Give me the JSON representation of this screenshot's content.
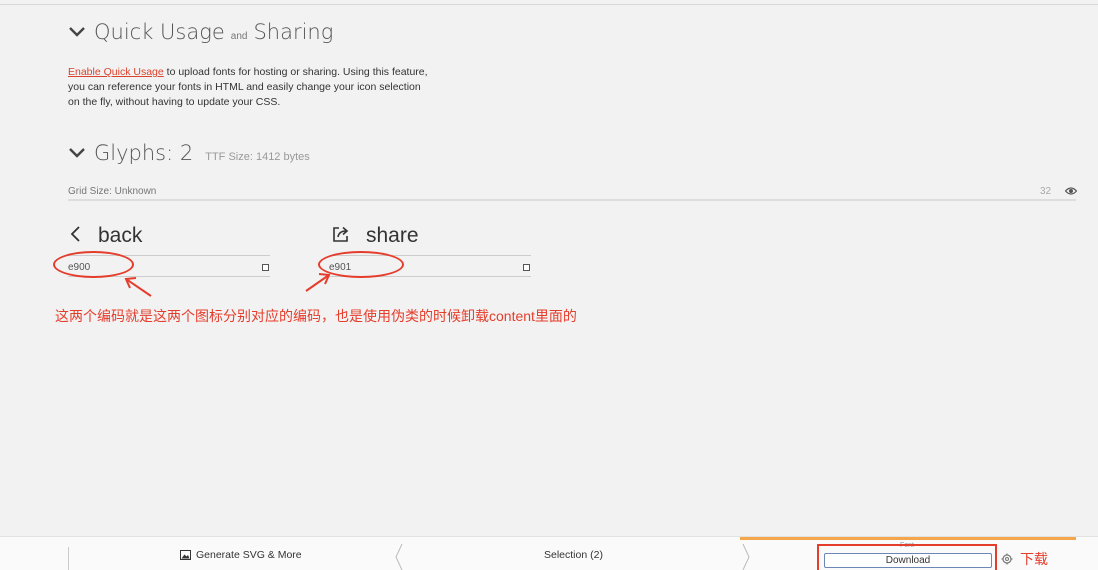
{
  "quick_usage": {
    "title_part1": "Quick Usage",
    "title_part2": "and",
    "title_part3": "Sharing",
    "link_text": "Enable Quick Usage",
    "description": " to upload fonts for hosting or sharing. Using this feature, you can reference your fonts in HTML and easily change your icon selection on the fly, without having to update your CSS."
  },
  "glyphs": {
    "title": "Glyphs: 2",
    "ttf_size": "TTF Size: 1412 bytes",
    "grid_label": "Grid Size: Unknown",
    "grid_size": "32",
    "items": [
      {
        "name": "back",
        "code": "e900",
        "icon": "chevron-left-icon"
      },
      {
        "name": "share",
        "code": "e901",
        "icon": "share-icon"
      }
    ]
  },
  "annotations": {
    "glyph_note": "这两个编码就是这两个图标分别对应的编码，也是使用伪类的时候卸载content里面的",
    "download_note": "下载"
  },
  "footer": {
    "generate_label": "Generate SVG & More",
    "selection_label": "Selection (2)",
    "font_label": "Font",
    "download_label": "Download"
  },
  "colors": {
    "accent_red": "#e53d2c",
    "link_red": "#d9432e",
    "footer_orange": "#f3a64a",
    "download_border": "#6b87b8"
  }
}
